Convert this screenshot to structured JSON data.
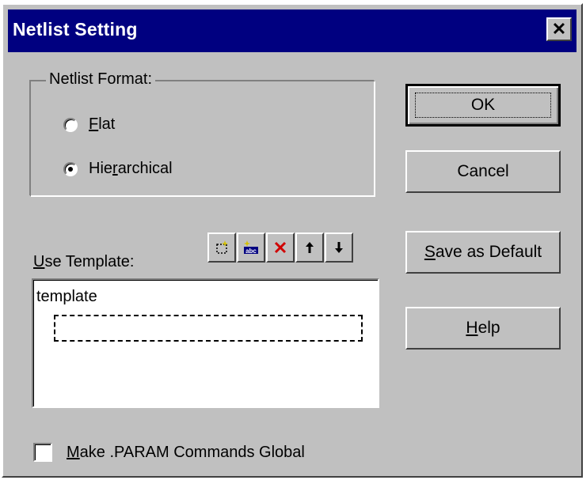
{
  "window": {
    "title": "Netlist Setting",
    "close_symbol": "✕"
  },
  "format_group": {
    "legend": "Netlist Format:",
    "options": [
      {
        "accel": "F",
        "rest": "lat",
        "checked": false
      },
      {
        "pre": "Hie",
        "accel": "r",
        "rest": "archical",
        "checked": true
      }
    ]
  },
  "buttons": {
    "ok": "OK",
    "cancel": "Cancel",
    "save_accel": "S",
    "save_rest": "ave as Default",
    "help_accel": "H",
    "help_rest": "elp"
  },
  "template": {
    "label_accel": "U",
    "label_rest": "se Template:",
    "items": [
      "template"
    ],
    "toolbar_icons": [
      "new-icon",
      "rename-icon",
      "delete-icon",
      "move-up-icon",
      "move-down-icon"
    ]
  },
  "param_option": {
    "accel": "M",
    "rest": "ake .PARAM Commands Global",
    "checked": false
  },
  "colors": {
    "face": "#c0c0c0",
    "title_bar": "#000080",
    "delete_red": "#d00000"
  }
}
